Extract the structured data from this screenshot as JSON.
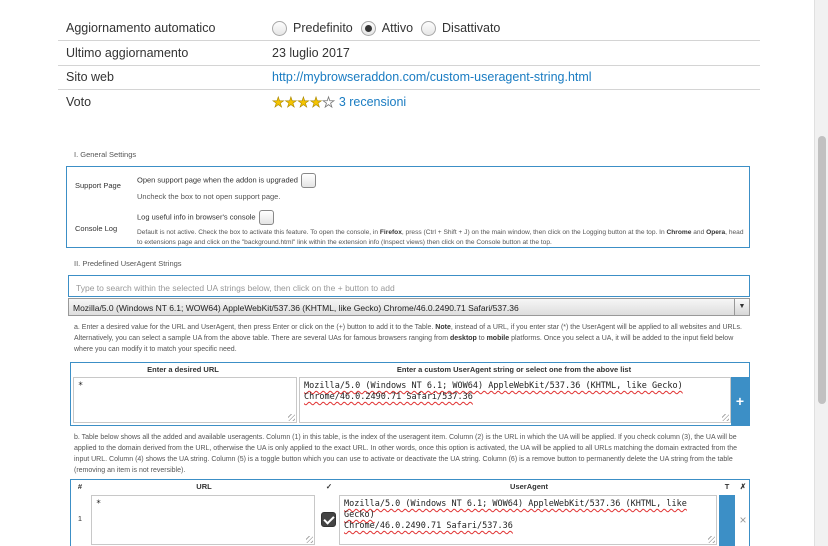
{
  "details": {
    "auto_update": {
      "label": "Aggiornamento automatico",
      "options": [
        "Predefinito",
        "Attivo",
        "Disattivato"
      ],
      "selected": "Attivo"
    },
    "last_update": {
      "label": "Ultimo aggiornamento",
      "value": "23 luglio 2017"
    },
    "website": {
      "label": "Sito web",
      "value": "http://mybrowseraddon.com/custom-useragent-string.html"
    },
    "rating": {
      "label": "Voto",
      "stars": 4,
      "out_of": 5,
      "reviews": "3 recensioni"
    }
  },
  "general": {
    "title": "I. General Settings",
    "support_label": "Support Page",
    "support_option": "Open support page when the addon is upgraded",
    "support_hint": "Uncheck the box to not open support page.",
    "console_label": "Console Log",
    "console_option": "Log useful info in browser's console",
    "console_hint_1": "Default is not active. Check the box to activate this feature. To open the console, in ",
    "console_hint_firefox": "Firefox",
    "console_hint_2": ", press (Ctrl + Shift + J) on the main window, then click on the Logging button at the top. In ",
    "console_hint_chrome": "Chrome",
    "console_hint_3": " and ",
    "console_hint_opera": "Opera",
    "console_hint_4": ", head to extensions page and click on the \"background.html\" link within the extension info (Inspect views) then click on the Console button at the top."
  },
  "predefined": {
    "title": "II. Predefined UserAgent Strings",
    "search_placeholder": "Type to search within the selected UA strings below, then click on the + button to add",
    "selected_ua": "Mozilla/5.0 (Windows NT 6.1; WOW64) AppleWebKit/537.36 (KHTML, like Gecko) Chrome/46.0.2490.71 Safari/537.36",
    "note_a_1": "a. Enter a desired value for the URL and UserAgent, then press Enter or click on the (+) button to add it to the Table. ",
    "note_a_bold": "Note",
    "note_a_2": ", instead of a URL, if you enter star (*) the UserAgent will be applied to all websites and URLs. Alternatively, you can select a sample UA from the above table. There are several UAs for famous browsers ranging from ",
    "note_a_desktop": "desktop",
    "note_a_3": " to ",
    "note_a_mobile": "mobile",
    "note_a_4": " platforms. Once you select a UA, it will be added to the input field below where you can modify it to match your specific need.",
    "url_header": "Enter a desired URL",
    "ua_header": "Enter a custom UserAgent string or select one from the above list",
    "url_value": "*",
    "ua_value_line1": "Mozilla/5.0 (Windows NT 6.1; WOW64) AppleWebKit/537.36 (KHTML, like Gecko)",
    "ua_value_line2": "Chrome/46.0.2490.71 Safari/537.36",
    "add_label": "+",
    "note_b": "b. Table below shows all the added and available useragents. Column (1) in this table, is the index of the useragent item. Column (2) is the URL in which the UA will be applied. If you check column (3), the UA will be applied to the domain derived from the URL, otherwise the UA is only applied to the exact URL. In other words, once this option is activated, the UA will be applied to all URLs matching the domain extracted from the input URL. Column (4) shows the UA string. Column (5) is a toggle button which you can use to activate or deactivate the UA string. Column (6) is a remove button to permanently delete the UA string from the table (removing an item is not reversible)."
  },
  "table": {
    "headers": [
      "#",
      "URL",
      "✓",
      "UserAgent",
      "T",
      "✗"
    ],
    "rows": [
      {
        "index": "1",
        "url": "*",
        "ua_line1": "Mozilla/5.0 (Windows NT 6.1; WOW64) AppleWebKit/537.36 (KHTML, like Gecko)",
        "ua_line2": "Chrome/46.0.2490.71 Safari/537.36",
        "remove": "×"
      }
    ]
  },
  "colors": {
    "accent": "#3c8fc6",
    "link": "#1a7cc2",
    "star": "#f5c400"
  },
  "icons": {
    "dropdown": "triangle-down-icon",
    "remove": "close-icon",
    "add": "plus-icon"
  }
}
